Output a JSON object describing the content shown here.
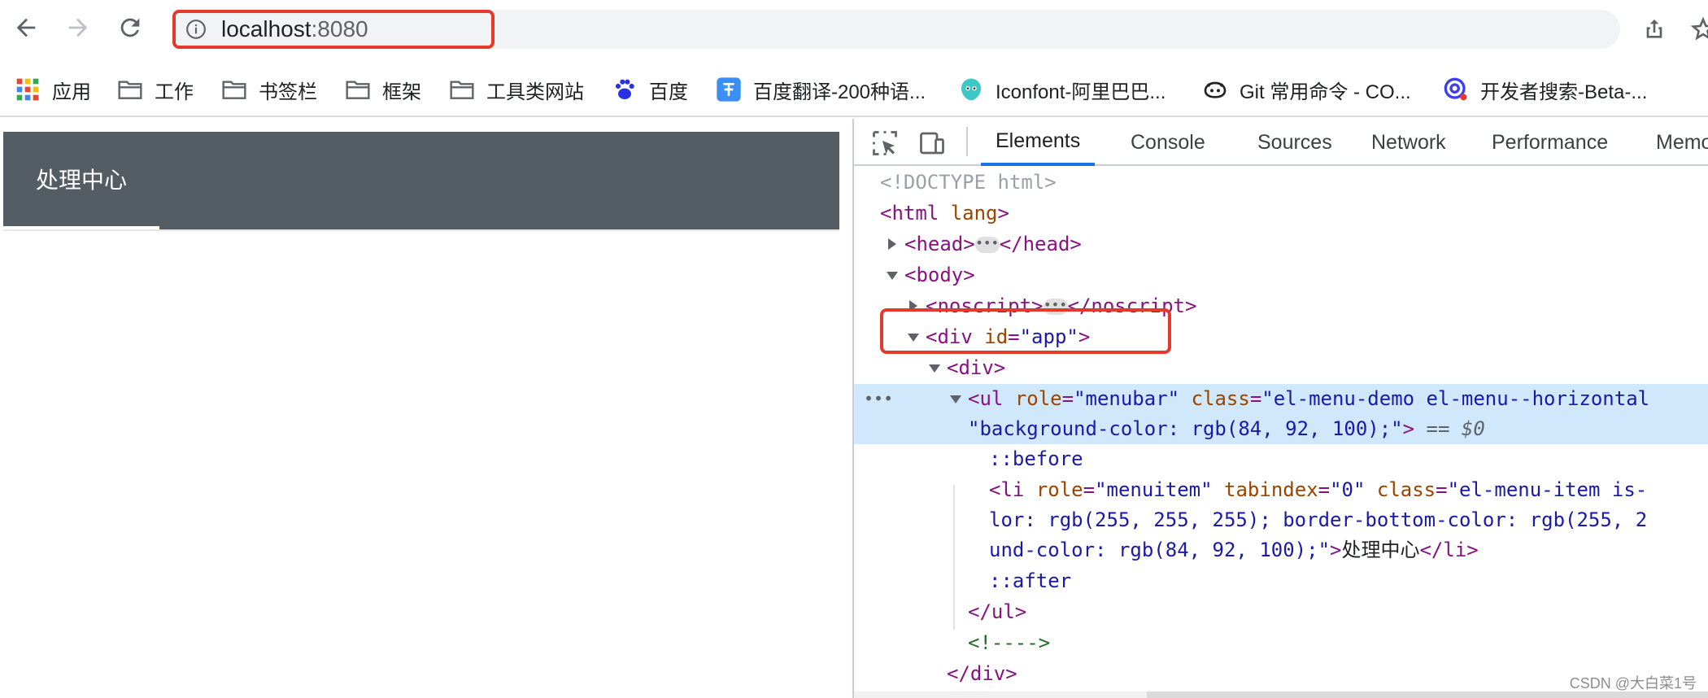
{
  "toolbar": {
    "url_host": "localhost",
    "url_port": ":8080",
    "icons": [
      "back-arrow-icon",
      "forward-arrow-icon",
      "reload-icon",
      "info-icon",
      "share-icon",
      "star-icon"
    ]
  },
  "bookmarks": {
    "items": [
      {
        "label": "应用",
        "icon": "apps-grid-icon"
      },
      {
        "label": "工作",
        "icon": "folder-icon"
      },
      {
        "label": "书签栏",
        "icon": "folder-icon"
      },
      {
        "label": "框架",
        "icon": "folder-icon"
      },
      {
        "label": "工具类网站",
        "icon": "folder-icon"
      },
      {
        "label": "百度",
        "icon": "baidu-paw-icon"
      },
      {
        "label": "百度翻译-200种语...",
        "icon": "translate-icon"
      },
      {
        "label": "Iconfont-阿里巴巴...",
        "icon": "iconfont-icon"
      },
      {
        "label": "Git 常用命令 - CO...",
        "icon": "github-cat-icon"
      },
      {
        "label": "开发者搜索-Beta-...",
        "icon": "dev-search-icon"
      }
    ]
  },
  "page": {
    "menu_item_label": "处理中心",
    "menu_bg_color": "#545c64"
  },
  "devtools": {
    "tabs": [
      "Elements",
      "Console",
      "Sources",
      "Network",
      "Performance",
      "Memo"
    ],
    "active_tab": "Elements",
    "dom": {
      "doctype": "<!DOCTYPE html>",
      "html_open": "<html",
      "html_attr": "lang",
      "html_close": ">",
      "head_open": "<head>",
      "head_close": "</head>",
      "body_open": "<body>",
      "noscript_open": "<noscript>",
      "noscript_close": "</noscript>",
      "div_open": "<div",
      "div_id_attr": "id",
      "div_id_val": "\"app\"",
      "div_gt": ">",
      "inner_div_open": "<div>",
      "ul_open": "<ul",
      "ul_role_attr": "role",
      "ul_role_val": "\"menubar\"",
      "ul_class_attr": "class",
      "ul_class_val": "\"el-menu-demo el-menu--horizontal",
      "ul_style_val": "\"background-color: rgb(84, 92, 100);\"",
      "ul_gt": ">",
      "eq_marker": "==",
      "dollar_zero": "$0",
      "before": "::before",
      "li_open": "<li",
      "li_role_attr": "role",
      "li_role_val": "\"menuitem\"",
      "li_tab_attr": "tabindex",
      "li_tab_val": "\"0\"",
      "li_class_attr": "class",
      "li_class_val": "\"el-menu-item is-",
      "li_style_2": "lor: rgb(255, 255, 255); border-bottom-color: rgb(255, 2",
      "li_style_3": "und-color: rgb(84, 92, 100);\"",
      "li_gt": ">",
      "li_text": "处理中心",
      "li_close": "</li>",
      "after": "::after",
      "ul_close": "</ul>",
      "comment": "<!---->",
      "div_close": "</div>"
    }
  },
  "watermark": "CSDN @大白菜1号",
  "colors": {
    "highlight_red": "#e53a2b",
    "selected_row": "#cfe8fc",
    "tab_active_underline": "#1a73e8"
  }
}
